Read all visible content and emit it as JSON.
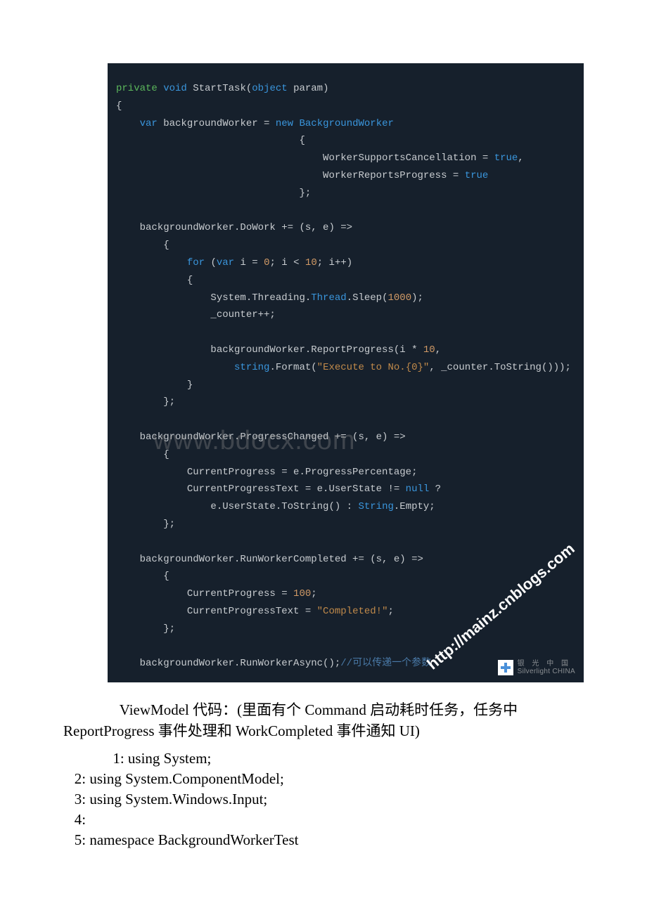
{
  "code": {
    "lines": [
      [
        {
          "t": "private",
          "c": "kw-access"
        },
        {
          "t": " ",
          "c": ""
        },
        {
          "t": "void",
          "c": "kw-type"
        },
        {
          "t": " StartTask(",
          "c": "punct"
        },
        {
          "t": "object",
          "c": "kw-type"
        },
        {
          "t": " param)",
          "c": "punct"
        }
      ],
      [
        {
          "t": "{",
          "c": "punct"
        }
      ],
      [
        {
          "t": "    ",
          "c": ""
        },
        {
          "t": "var",
          "c": "kw-var"
        },
        {
          "t": " backgroundWorker = ",
          "c": "punct"
        },
        {
          "t": "new",
          "c": "kw-new"
        },
        {
          "t": " ",
          "c": ""
        },
        {
          "t": "BackgroundWorker",
          "c": "kw-class"
        }
      ],
      [
        {
          "t": "                               {",
          "c": "punct"
        }
      ],
      [
        {
          "t": "                                   WorkerSupportsCancellation = ",
          "c": "punct"
        },
        {
          "t": "true",
          "c": "kw-bool"
        },
        {
          "t": ",",
          "c": "punct"
        }
      ],
      [
        {
          "t": "                                   WorkerReportsProgress = ",
          "c": "punct"
        },
        {
          "t": "true",
          "c": "kw-bool"
        }
      ],
      [
        {
          "t": "                               };",
          "c": "punct"
        }
      ],
      [
        {
          "t": "",
          "c": ""
        }
      ],
      [
        {
          "t": "    backgroundWorker.DoWork += (s, e) =>",
          "c": "punct"
        }
      ],
      [
        {
          "t": "        {",
          "c": "punct"
        }
      ],
      [
        {
          "t": "            ",
          "c": ""
        },
        {
          "t": "for",
          "c": "kw-for"
        },
        {
          "t": " (",
          "c": "punct"
        },
        {
          "t": "var",
          "c": "kw-var"
        },
        {
          "t": " i = ",
          "c": "punct"
        },
        {
          "t": "0",
          "c": "num"
        },
        {
          "t": "; i < ",
          "c": "punct"
        },
        {
          "t": "10",
          "c": "num"
        },
        {
          "t": "; i++)",
          "c": "punct"
        }
      ],
      [
        {
          "t": "            {",
          "c": "punct"
        }
      ],
      [
        {
          "t": "                System.Threading.",
          "c": "punct"
        },
        {
          "t": "Thread",
          "c": "kw-class"
        },
        {
          "t": ".Sleep(",
          "c": "punct"
        },
        {
          "t": "1000",
          "c": "num"
        },
        {
          "t": ");",
          "c": "punct"
        }
      ],
      [
        {
          "t": "                _counter++;",
          "c": "punct"
        }
      ],
      [
        {
          "t": "",
          "c": ""
        }
      ],
      [
        {
          "t": "                backgroundWorker.ReportProgress(i * ",
          "c": "punct"
        },
        {
          "t": "10",
          "c": "num"
        },
        {
          "t": ",",
          "c": "punct"
        }
      ],
      [
        {
          "t": "                    ",
          "c": ""
        },
        {
          "t": "string",
          "c": "kw-string"
        },
        {
          "t": ".Format(",
          "c": "punct"
        },
        {
          "t": "\"Execute to No.{0}\"",
          "c": "str-lit"
        },
        {
          "t": ", _counter.ToString()));",
          "c": "punct"
        }
      ],
      [
        {
          "t": "            }",
          "c": "punct"
        }
      ],
      [
        {
          "t": "        };",
          "c": "punct"
        }
      ],
      [
        {
          "t": "",
          "c": ""
        }
      ],
      [
        {
          "t": "    backgroundWorker.ProgressChanged += (s, e) =>",
          "c": "punct"
        }
      ],
      [
        {
          "t": "        {",
          "c": "punct"
        }
      ],
      [
        {
          "t": "            CurrentProgress = e.ProgressPercentage;",
          "c": "punct"
        }
      ],
      [
        {
          "t": "            CurrentProgressText = e.UserState != ",
          "c": "punct"
        },
        {
          "t": "null",
          "c": "kw-null"
        },
        {
          "t": " ?",
          "c": "punct"
        }
      ],
      [
        {
          "t": "                e.UserState.ToString() : ",
          "c": "punct"
        },
        {
          "t": "String",
          "c": "kw-class"
        },
        {
          "t": ".Empty;",
          "c": "punct"
        }
      ],
      [
        {
          "t": "        };",
          "c": "punct"
        }
      ],
      [
        {
          "t": "",
          "c": ""
        }
      ],
      [
        {
          "t": "    backgroundWorker.RunWorkerCompleted += (s, e) =>",
          "c": "punct"
        }
      ],
      [
        {
          "t": "        {",
          "c": "punct"
        }
      ],
      [
        {
          "t": "            CurrentProgress = ",
          "c": "punct"
        },
        {
          "t": "100",
          "c": "num"
        },
        {
          "t": ";",
          "c": "punct"
        }
      ],
      [
        {
          "t": "            CurrentProgressText = ",
          "c": "punct"
        },
        {
          "t": "\"Completed!\"",
          "c": "str-lit"
        },
        {
          "t": ";",
          "c": "punct"
        }
      ],
      [
        {
          "t": "        };",
          "c": "punct"
        }
      ],
      [
        {
          "t": "",
          "c": ""
        }
      ],
      [
        {
          "t": "    backgroundWorker.RunWorkerAsync();",
          "c": "punct"
        },
        {
          "t": "//可以传递一个参数",
          "c": "comment"
        }
      ]
    ]
  },
  "watermarks": {
    "domain": "www.bdocx.com",
    "blog": "http://mainz.cnblogs.com"
  },
  "logo": {
    "cn": "银 光 中 国",
    "en": "Silverlight CHINA"
  },
  "prose": {
    "p1": "ViewModel 代码：(里面有个 Command 启动耗时任务，任务中 ReportProgress 事件处理和 WorkCompleted 事件通知 UI)"
  },
  "listing": [
    "   1: using System;",
    "   2: using System.ComponentModel;",
    "   3: using System.Windows.Input;",
    "   4:",
    "   5: namespace BackgroundWorkerTest"
  ]
}
